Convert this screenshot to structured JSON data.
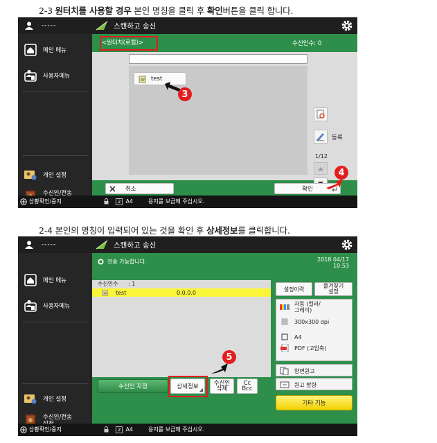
{
  "step3": {
    "heading_num": "2-3",
    "heading_bold1": "원터치를 사용할 경우",
    "heading_mid": " 본인 명칭을 클릭 후 ",
    "heading_bold2": "확인",
    "heading_end": "버튼을 클릭 합니다.",
    "marker_a": "3",
    "marker_b": "4"
  },
  "step4": {
    "heading_num": "2-4",
    "heading_mid": " 본인의 명칭이 입력되어 있는 것을 확인 후 ",
    "heading_bold": "상세정보",
    "heading_end": "를 클릭합니다.",
    "marker": "5"
  },
  "common": {
    "user_dash": "-----",
    "app_title": "스캔하고 송신",
    "menu_main": "메인 메뉴",
    "menu_personal": "사용자메뉴",
    "menu_personal_settings": "개인 설정",
    "menu_recipient_line1": "수신인/전송",
    "menu_recipient_line2": "설정",
    "status_check": "상황확인/중지",
    "paper_size": "A4",
    "status_message": "용지를 보급해 주십시오."
  },
  "screen1": {
    "onetouch_tab": "<원터치(로컬)>",
    "recipient_count": "수신인수: 0",
    "item_label": "test",
    "register_label": "등록",
    "page_indicator": "1/12",
    "cancel_label": "취소",
    "ok_label": "확인"
  },
  "screen2": {
    "status_text": "전송 가능합니다.",
    "date": "2018 04/17",
    "time": "10:53",
    "list_header_label": "수신인수",
    "list_header_count": ": 1",
    "row_name": "test",
    "row_value": "0.0.0.0",
    "specify_recipient": "수신인 지정",
    "details": "상세정보",
    "delete_line1": "수신인",
    "delete_line2": "삭제",
    "cc_line1": "Cc",
    "cc_line2": "Bcc",
    "history": "설정이력",
    "favorites_line1": "즐겨찾기",
    "favorites_line2": "설정",
    "color_line1": "자동 (컬러/",
    "color_line2": "그레이)",
    "resolution": "300x300 dpi",
    "size": "A4",
    "format_line1": "PDF (고압축)",
    "duplex": "양면원고",
    "orientation": "원고 방향",
    "other_functions": "기타 기능"
  }
}
